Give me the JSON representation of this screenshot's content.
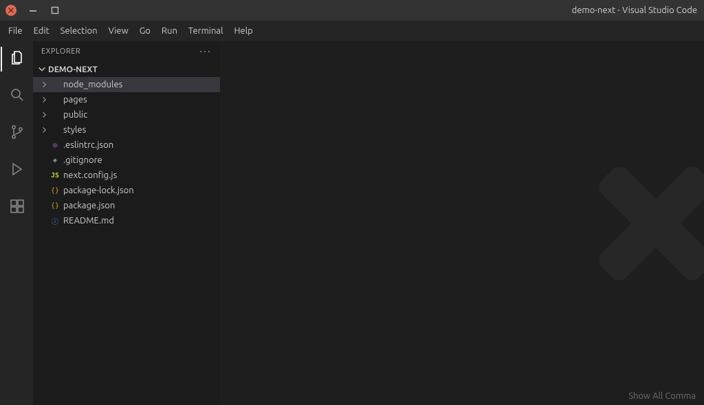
{
  "title": "demo-next - Visual Studio Code",
  "menubar": [
    "File",
    "Edit",
    "Selection",
    "View",
    "Go",
    "Run",
    "Terminal",
    "Help"
  ],
  "sidebar": {
    "header": "EXPLORER",
    "project": "DEMO-NEXT",
    "tree": [
      {
        "name": "node_modules",
        "kind": "folder",
        "selected": true
      },
      {
        "name": "pages",
        "kind": "folder",
        "selected": false
      },
      {
        "name": "public",
        "kind": "folder",
        "selected": false
      },
      {
        "name": "styles",
        "kind": "folder",
        "selected": false
      },
      {
        "name": ".eslintrc.json",
        "kind": "file",
        "icon": "eslint"
      },
      {
        "name": ".gitignore",
        "kind": "file",
        "icon": "git"
      },
      {
        "name": "next.config.js",
        "kind": "file",
        "icon": "js"
      },
      {
        "name": "package-lock.json",
        "kind": "file",
        "icon": "json"
      },
      {
        "name": "package.json",
        "kind": "file",
        "icon": "json"
      },
      {
        "name": "README.md",
        "kind": "file",
        "icon": "info"
      }
    ]
  },
  "editor": {
    "hint": "Show All Comma"
  },
  "icons": {
    "eslint": "◎",
    "git": "◆",
    "js": "JS",
    "json": "{}",
    "info": "ⓘ"
  }
}
